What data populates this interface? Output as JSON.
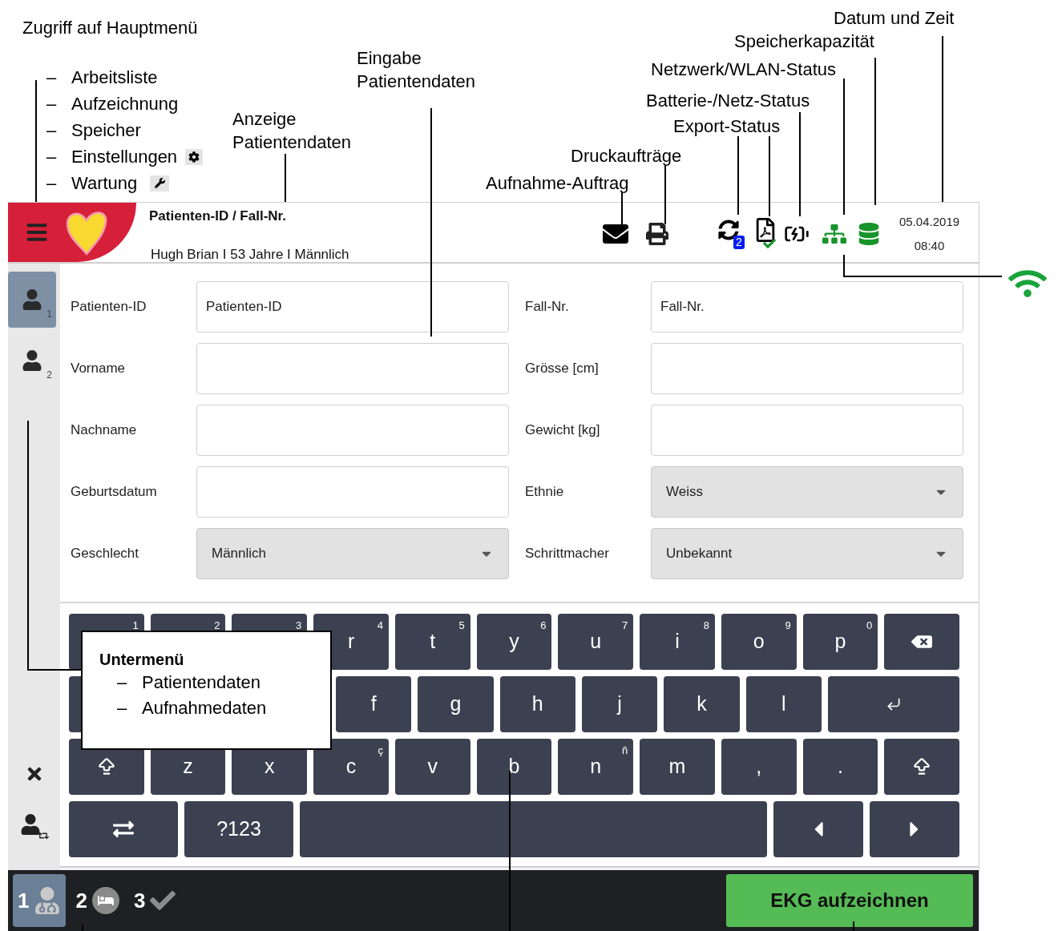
{
  "annotations": {
    "main_menu": {
      "title": "Zugriff auf Hauptmenü",
      "items": [
        {
          "marker": "–",
          "label": "Arbeitsliste",
          "kind": "plain"
        },
        {
          "marker": "–",
          "label": "Aufzeichnung",
          "kind": "plain"
        },
        {
          "marker": "–",
          "label": "Speicher",
          "kind": "plain"
        },
        {
          "marker": "–",
          "label": "Einstellungen",
          "kind": "settings"
        },
        {
          "marker": "–",
          "label": "Wartung",
          "kind": "service"
        }
      ]
    },
    "labels": [
      "Eingabe Patientendaten",
      "Anzeige Patientendaten",
      "Datum und Zeit",
      "Speicherkapazität",
      "Netzwerk/WLAN-Status",
      "Batterie-/Netz-Status",
      "Export-Status",
      "Druckaufträge",
      "Aufnahme-Auftrag"
    ],
    "submenu": {
      "title": "Untermenü",
      "items": [
        {
          "marker": "–",
          "label": "Patientendaten"
        },
        {
          "marker": "–",
          "label": "Aufnahmedaten"
        }
      ]
    }
  },
  "header": {
    "title": "Patienten-ID / Fall-Nr.",
    "patient": "Hugh Brian I 53 Jahre I Männlich",
    "export_count": "2",
    "date": "05.04.2019",
    "time": "08:40"
  },
  "sidebar": {
    "patients": [
      {
        "number": "1",
        "selected": true
      },
      {
        "number": "2",
        "selected": false
      }
    ]
  },
  "form": {
    "left": [
      {
        "label": "Patienten-ID",
        "kind": "input",
        "placeholder": "Patienten-ID"
      },
      {
        "label": "Vorname",
        "kind": "input"
      },
      {
        "label": "Nachname",
        "kind": "input"
      },
      {
        "label": "Geburtsdatum",
        "kind": "input"
      },
      {
        "label": "Geschlecht",
        "kind": "select",
        "value": "Männlich"
      }
    ],
    "right": [
      {
        "label": "Fall-Nr.",
        "kind": "input",
        "placeholder": "Fall-Nr."
      },
      {
        "label": "Grösse [cm]",
        "kind": "input"
      },
      {
        "label": "Gewicht [kg]",
        "kind": "input"
      },
      {
        "label": "Ethnie",
        "kind": "select",
        "value": "Weiss"
      },
      {
        "label": "Schrittmacher",
        "kind": "select",
        "value": "Unbekannt"
      }
    ]
  },
  "keyboard": [
    [
      {
        "kind": "key",
        "sup": "1"
      },
      {
        "kind": "key",
        "sup": "2"
      },
      {
        "kind": "key",
        "sup": "3"
      },
      {
        "kind": "key",
        "label": "r",
        "sup": "4"
      },
      {
        "kind": "key",
        "label": "t",
        "sup": "5"
      },
      {
        "kind": "key",
        "label": "y",
        "sup": "6"
      },
      {
        "kind": "key",
        "label": "u",
        "sup": "7"
      },
      {
        "kind": "key",
        "label": "i",
        "sup": "8"
      },
      {
        "kind": "key",
        "label": "o",
        "sup": "9"
      },
      {
        "kind": "key",
        "label": "p",
        "sup": "0"
      },
      {
        "kind": "backspace"
      }
    ],
    [
      {
        "kind": "blank"
      },
      {
        "kind": "key",
        "label": "f"
      },
      {
        "kind": "key",
        "label": "g"
      },
      {
        "kind": "key",
        "label": "h"
      },
      {
        "kind": "key",
        "label": "j"
      },
      {
        "kind": "key",
        "label": "k"
      },
      {
        "kind": "key",
        "label": "l"
      },
      {
        "kind": "enter"
      }
    ],
    [
      {
        "kind": "shift"
      },
      {
        "kind": "key",
        "label": "z"
      },
      {
        "kind": "key",
        "label": "x"
      },
      {
        "kind": "key",
        "label": "c",
        "sup": "ç"
      },
      {
        "kind": "key",
        "label": "v"
      },
      {
        "kind": "key",
        "label": "b"
      },
      {
        "kind": "key",
        "label": "n",
        "sup": "ñ"
      },
      {
        "kind": "key",
        "label": "m"
      },
      {
        "kind": "key",
        "label": ","
      },
      {
        "kind": "key",
        "label": "."
      },
      {
        "kind": "shift"
      }
    ],
    [
      {
        "kind": "swap"
      },
      {
        "kind": "key",
        "label": "?123"
      },
      {
        "kind": "space"
      },
      {
        "kind": "left"
      },
      {
        "kind": "right"
      }
    ]
  ],
  "steps": [
    {
      "number": "1",
      "kind": "doctor",
      "selected": true
    },
    {
      "number": "2",
      "kind": "bed",
      "selected": false
    },
    {
      "number": "3",
      "kind": "check",
      "selected": false
    }
  ],
  "record_button": "EKG aufzeichnen"
}
